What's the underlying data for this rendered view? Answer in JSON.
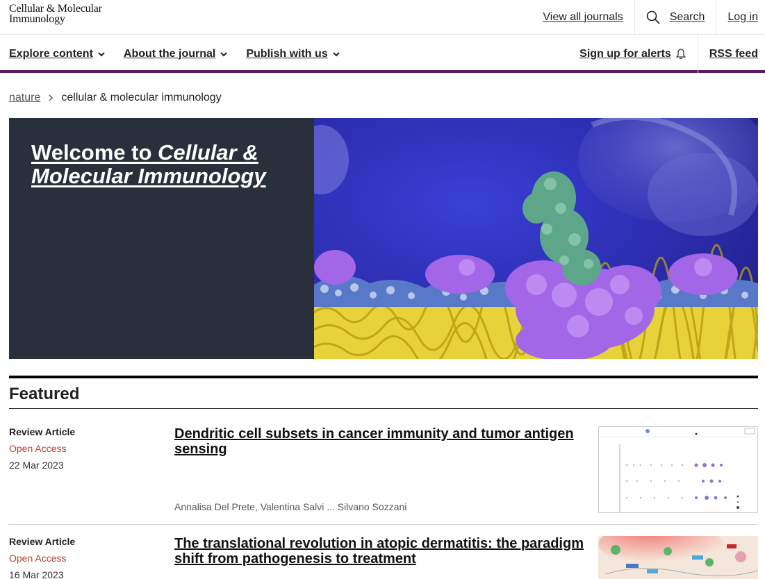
{
  "header": {
    "logo_line1": "Cellular & Molecular",
    "logo_line2": "Immunology",
    "view_all_journals": "View all journals",
    "search_label": "Search",
    "login_label": "Log in"
  },
  "nav": {
    "items": [
      {
        "label": "Explore content"
      },
      {
        "label": "About the journal"
      },
      {
        "label": "Publish with us"
      }
    ],
    "alerts_label": "Sign up for alerts",
    "rss_label": "RSS feed",
    "accent_color": "#5b1c64"
  },
  "breadcrumb": {
    "root": "nature",
    "current": "cellular & molecular immunology"
  },
  "hero": {
    "title_prefix": "Welcome to ",
    "title_journal": "Cellular & Molecular Immunology"
  },
  "featured": {
    "heading": "Featured",
    "articles": [
      {
        "type": "Review Article",
        "access": "Open Access",
        "date": "22 Mar 2023",
        "title": "Dendritic cell subsets in cancer immunity and tumor antigen sensing",
        "authors": "Annalisa Del Prete, Valentina Salvi ... Silvano Sozzani"
      },
      {
        "type": "Review Article",
        "access": "Open Access",
        "date": "16 Mar 2023",
        "title": "The translational revolution in atopic dermatitis: the paradigm shift from pathogenesis to treatment"
      }
    ]
  }
}
